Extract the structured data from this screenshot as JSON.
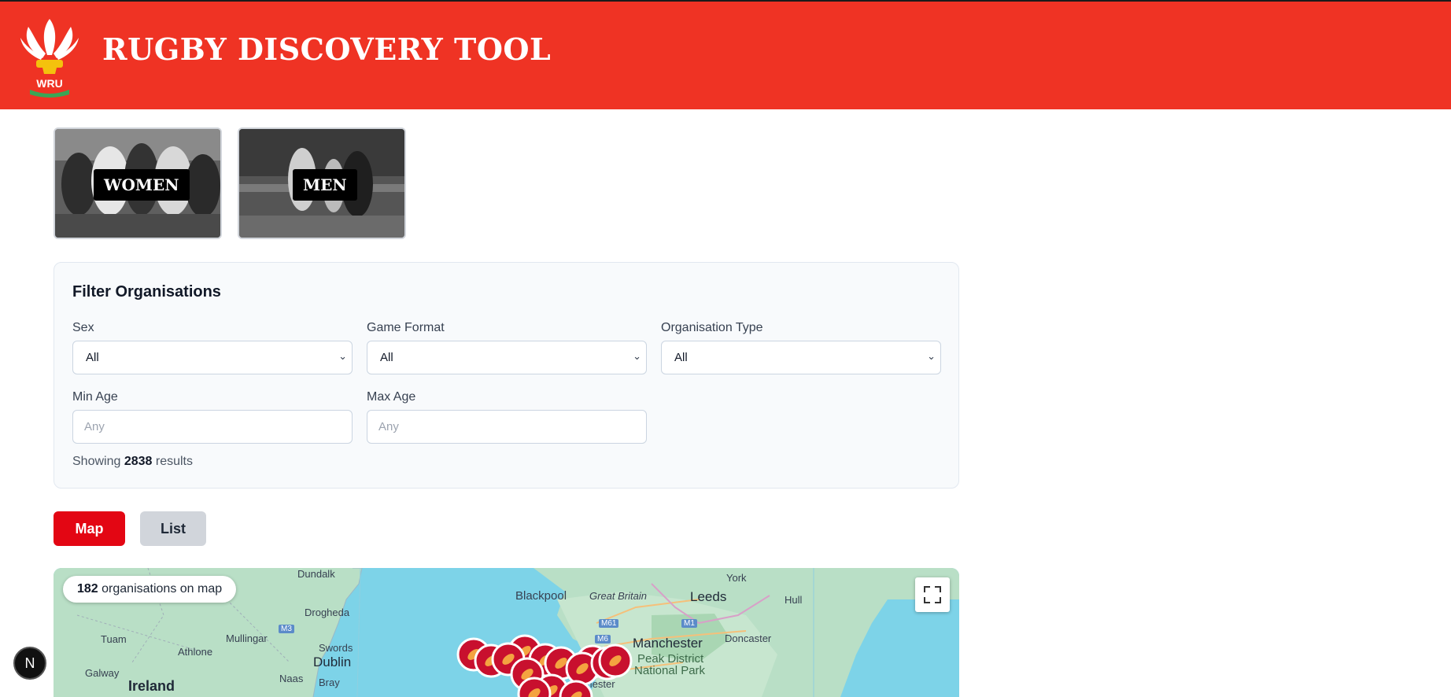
{
  "header": {
    "title": "RUGBY DISCOVERY TOOL",
    "logo_text": "WRU",
    "logo_icon": "prince-of-wales-feathers-icon"
  },
  "categories": [
    {
      "label": "WOMEN"
    },
    {
      "label": "MEN"
    }
  ],
  "filters": {
    "title": "Filter Organisations",
    "sex": {
      "label": "Sex",
      "value": "All"
    },
    "game_format": {
      "label": "Game Format",
      "value": "All"
    },
    "organisation_type": {
      "label": "Organisation Type",
      "value": "All"
    },
    "min_age": {
      "label": "Min Age",
      "placeholder": "Any"
    },
    "max_age": {
      "label": "Max Age",
      "placeholder": "Any"
    },
    "results_prefix": "Showing",
    "results_count": "2838",
    "results_suffix": "results"
  },
  "view_toggle": {
    "map_label": "Map",
    "list_label": "List",
    "active": "Map"
  },
  "map": {
    "count": "182",
    "count_suffix": "organisations on map",
    "places": {
      "dundalk": "Dundalk",
      "drogheda": "Drogheda",
      "tuam": "Tuam",
      "mullingar": "Mullingar",
      "athlone": "Athlone",
      "swords": "Swords",
      "dublin": "Dublin",
      "galway": "Galway",
      "naas": "Naas",
      "bray": "Bray",
      "ireland": "Ireland",
      "m3": "M3",
      "blackpool": "Blackpool",
      "great_britain": "Great Britain",
      "york": "York",
      "leeds": "Leeds",
      "hull": "Hull",
      "m61": "M61",
      "m6": "M6",
      "m1": "M1",
      "manchester": "Manchester",
      "doncaster": "Doncaster",
      "peak_district_1": "Peak District",
      "peak_district_2": "National Park",
      "chester": "Chester"
    },
    "marker_icon": "rugby-ball-icon",
    "colors": {
      "sea": "#7dd3e8",
      "land": "#b9dfc6",
      "marker": "#c8102e"
    }
  },
  "dev_badge": {
    "label": "N"
  },
  "colors": {
    "header": "#ef3324",
    "primary": "#e30613"
  }
}
